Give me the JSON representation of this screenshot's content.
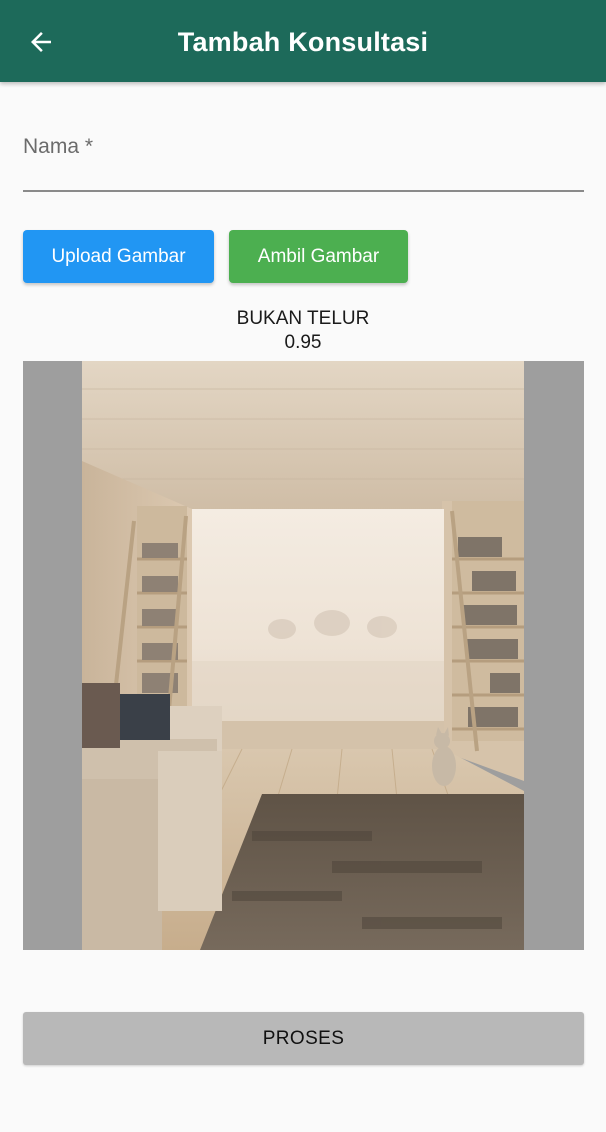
{
  "header": {
    "title": "Tambah Konsultasi",
    "back_icon": "arrow-left-icon",
    "background": "#1d6a5a"
  },
  "form": {
    "name_label": "Nama *",
    "name_value": ""
  },
  "buttons": {
    "upload_label": "Upload Gambar",
    "upload_color": "#2196f3",
    "capture_label": "Ambil Gambar",
    "capture_color": "#4caf50",
    "process_label": "PROSES"
  },
  "result": {
    "label": "BUKAN TELUR",
    "confidence": "0.95"
  },
  "preview": {
    "image_icon": "room-photo"
  }
}
